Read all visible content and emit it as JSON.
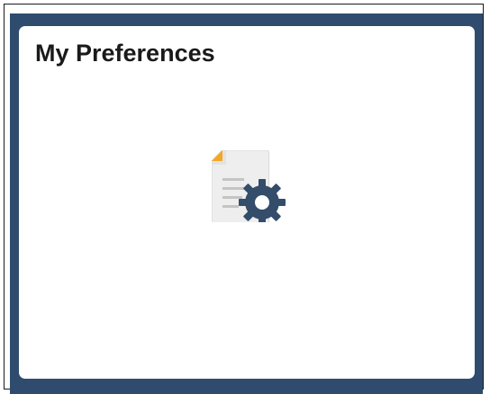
{
  "tile": {
    "title": "My Preferences",
    "icon": "document-gear-icon"
  },
  "colors": {
    "tile_border": "#2f4c6e",
    "tile_background": "#ffffff",
    "title_text": "#1a1a1a",
    "document_body": "#eeeeee",
    "document_fold_corner": "#f5a623",
    "gear": "#334d6b"
  }
}
